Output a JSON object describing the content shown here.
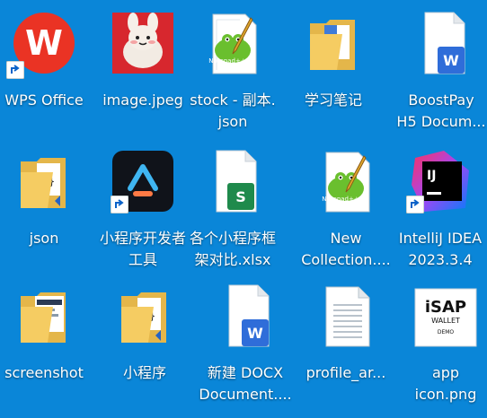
{
  "desktop": {
    "items": [
      {
        "name": "wps-office-shortcut",
        "icon": "wps-office-icon",
        "label_lines": [
          "WPS Office"
        ],
        "shortcut": true
      },
      {
        "name": "image-jpeg-file",
        "icon": "image-thumbnail-icon",
        "label_lines": [
          "image.jpeg"
        ],
        "shortcut": false
      },
      {
        "name": "stock-json-file",
        "icon": "notepadplusplus-file-icon",
        "label_lines": [
          "stock - 副本.",
          "json"
        ],
        "shortcut": false
      },
      {
        "name": "study-notes-folder",
        "icon": "folder-with-word-doc-icon",
        "label_lines": [
          "学习笔记"
        ],
        "shortcut": false
      },
      {
        "name": "boostpay-doc-file",
        "icon": "word-document-icon",
        "label_lines": [
          "BoostPay",
          "H5 Docum..."
        ],
        "shortcut": false
      },
      {
        "name": "json-folder",
        "icon": "folder-with-json-icon",
        "label_lines": [
          "json"
        ],
        "shortcut": false
      },
      {
        "name": "miniprogram-devtools-shortcut",
        "icon": "miniprogram-devtools-icon",
        "label_lines": [
          "小程序开发者",
          "工具"
        ],
        "shortcut": true
      },
      {
        "name": "miniprogram-compare-xlsx",
        "icon": "excel-spreadsheet-icon",
        "label_lines": [
          "各个小程序框",
          "架对比.xlsx"
        ],
        "shortcut": false
      },
      {
        "name": "new-collection-file",
        "icon": "notepadplusplus-file-icon",
        "label_lines": [
          "New",
          "Collection...."
        ],
        "shortcut": false
      },
      {
        "name": "intellij-idea-shortcut",
        "icon": "intellij-idea-icon",
        "label_lines": [
          "IntelliJ IDEA",
          "2023.3.4"
        ],
        "shortcut": true
      },
      {
        "name": "screenshot-folder",
        "icon": "folder-with-screenshot-icon",
        "label_lines": [
          "screenshot"
        ],
        "shortcut": false
      },
      {
        "name": "miniprogram-folder",
        "icon": "folder-with-json-icon",
        "label_lines": [
          "小程序"
        ],
        "shortcut": false
      },
      {
        "name": "new-docx-file",
        "icon": "word-document-icon",
        "label_lines": [
          "新建 DOCX",
          "Document...."
        ],
        "shortcut": false
      },
      {
        "name": "profile-file",
        "icon": "blank-document-icon",
        "label_lines": [
          "profile_ar..."
        ],
        "shortcut": false
      },
      {
        "name": "app-icon-png-file",
        "icon": "isap-wallet-thumbnail-icon",
        "label_lines": [
          "app",
          "icon.png"
        ],
        "shortcut": false
      }
    ]
  },
  "wps_logo_text": "W",
  "word_badge_text": "W",
  "excel_badge_text": "S",
  "idea_text": "IJ",
  "isap_title": "iSAP",
  "isap_sub": "WALLET",
  "isap_demo": "DEMO",
  "npp_label": "Notepad++",
  "json_braces": "{}"
}
